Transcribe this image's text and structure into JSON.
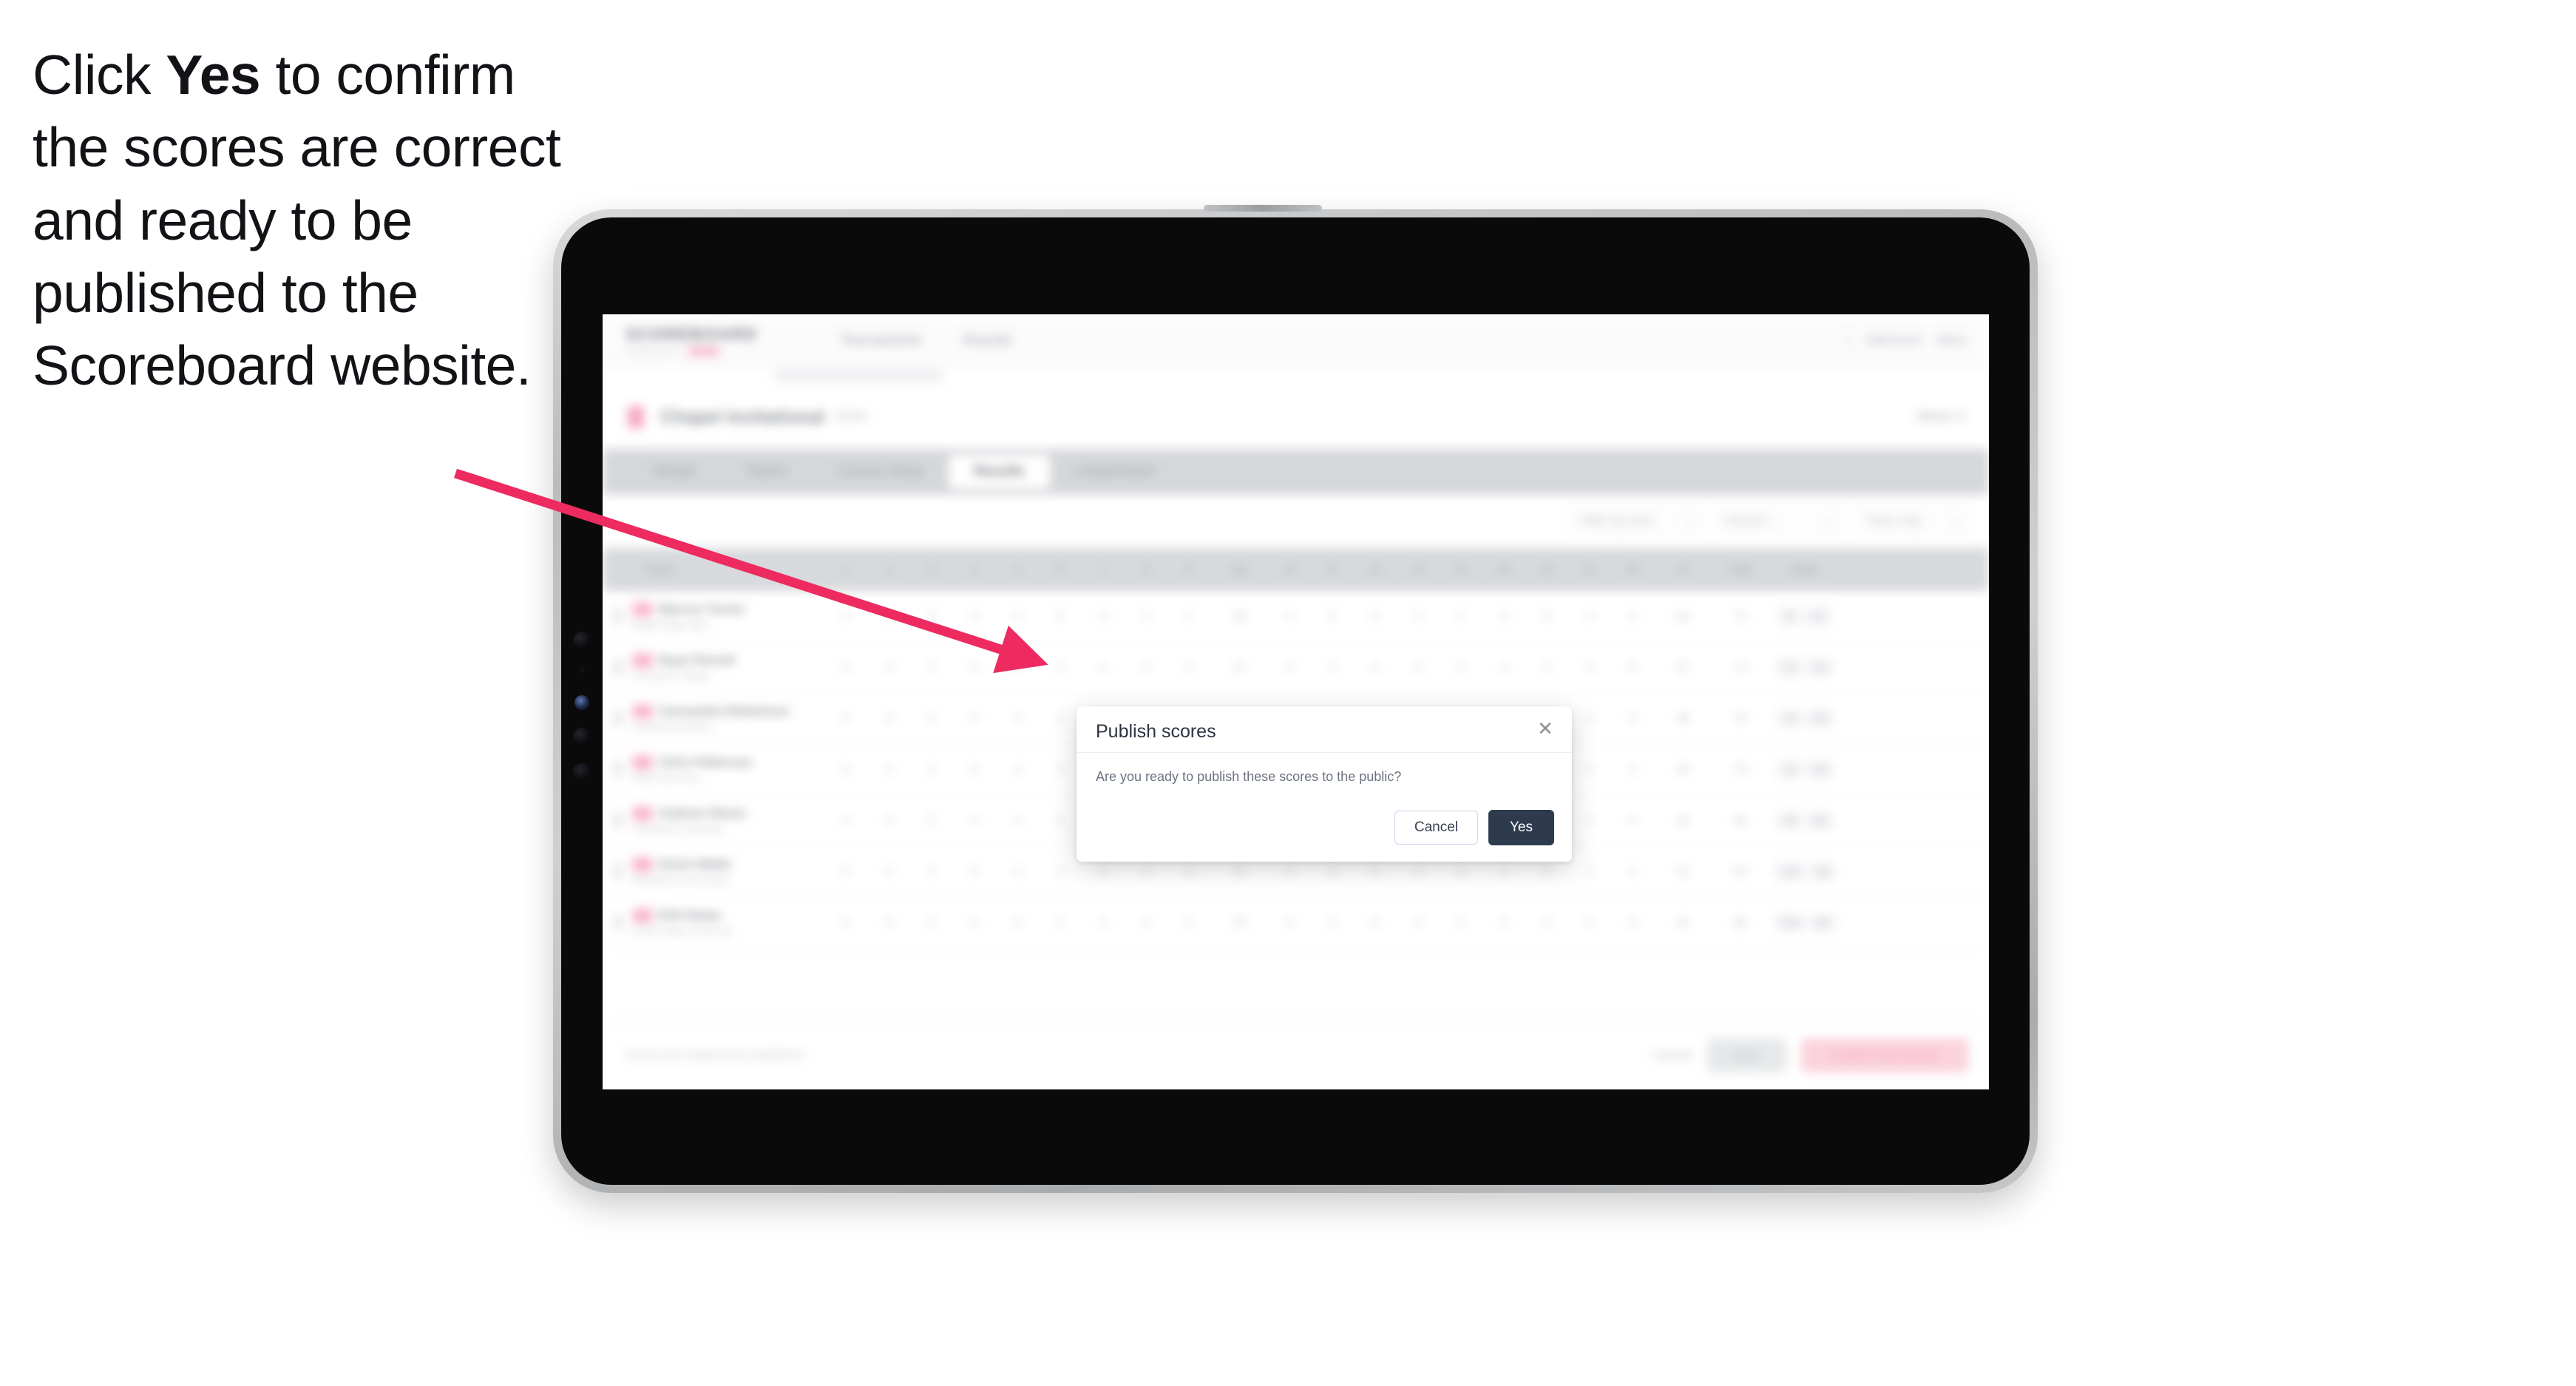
{
  "instruction": {
    "prefix": "Click ",
    "emphasis": "Yes",
    "suffix": " to confirm the scores are correct and ready to be published to the Scoreboard website."
  },
  "colors": {
    "arrow": "#ED2B60",
    "modal_primary": "#2E3B4E",
    "modal_cancel_border": "#CBD6E8",
    "brand_pink": "#F8B6C8",
    "device_bezel": "#C6C7C9"
  },
  "device": {
    "type": "tablet",
    "orientation": "landscape"
  },
  "app": {
    "brand": {
      "name": "SCOREBOARD",
      "tagline": "POWERED BY",
      "badge": ""
    },
    "nav": [
      {
        "label": "Tournaments"
      },
      {
        "label": "Rounds"
      }
    ],
    "nav_right": [
      {
        "label": "Add Event"
      },
      {
        "label": "Menu"
      }
    ],
    "subnav_chip": "",
    "event": {
      "title": "Chapel Invitational",
      "subtitle": "2024",
      "right_label": "Week 3"
    },
    "tabs": [
      {
        "label": "Details",
        "active": false
      },
      {
        "label": "Teams",
        "active": false
      },
      {
        "label": "Course Setup",
        "active": false
      },
      {
        "label": "Results",
        "active": true
      },
      {
        "label": "Leaderboard",
        "active": false
      }
    ],
    "filters": [
      {
        "label": "Filter by team",
        "type": "select"
      },
      {
        "label": "Round 1",
        "type": "select"
      },
      {
        "label": "Team only",
        "type": "select"
      }
    ],
    "table": {
      "columns": [
        {
          "label": "Player",
          "kind": "player"
        },
        {
          "label": "1",
          "kind": "hole"
        },
        {
          "label": "2",
          "kind": "hole"
        },
        {
          "label": "3",
          "kind": "hole"
        },
        {
          "label": "4",
          "kind": "hole"
        },
        {
          "label": "5",
          "kind": "hole"
        },
        {
          "label": "6",
          "kind": "hole"
        },
        {
          "label": "7",
          "kind": "hole"
        },
        {
          "label": "8",
          "kind": "hole"
        },
        {
          "label": "9",
          "kind": "hole"
        },
        {
          "label": "Out",
          "kind": "wide"
        },
        {
          "label": "10",
          "kind": "hole"
        },
        {
          "label": "11",
          "kind": "hole"
        },
        {
          "label": "12",
          "kind": "hole"
        },
        {
          "label": "13",
          "kind": "hole"
        },
        {
          "label": "14",
          "kind": "hole"
        },
        {
          "label": "15",
          "kind": "hole"
        },
        {
          "label": "16",
          "kind": "hole"
        },
        {
          "label": "17",
          "kind": "hole"
        },
        {
          "label": "18",
          "kind": "hole"
        },
        {
          "label": "In",
          "kind": "wide"
        },
        {
          "label": "Total",
          "kind": "wide"
        },
        {
          "label": "Status",
          "kind": "wider"
        }
      ],
      "rows": [
        {
          "rank": "1st",
          "name": "Marcus Turner",
          "sub": "Eagle Ridge High",
          "scores": [
            "4",
            "5",
            "3",
            "4",
            "4",
            "5",
            "3",
            "4",
            "4"
          ],
          "out": "36",
          "scores_in": [
            "4",
            "3",
            "5",
            "4",
            "4",
            "3",
            "5",
            "4",
            "4"
          ],
          "in": "36",
          "total": "72",
          "status_a": "E",
          "status_b": "72"
        },
        {
          "rank": "2nd",
          "name": "Ryan Parnell",
          "sub": "Crestview College",
          "scores": [
            "5",
            "4",
            "4",
            "3",
            "5",
            "4",
            "4",
            "4",
            "4"
          ],
          "out": "37",
          "scores_in": [
            "4",
            "4",
            "4",
            "5",
            "3",
            "4",
            "4",
            "4",
            "5"
          ],
          "in": "37",
          "total": "74",
          "status_a": "+2",
          "status_b": "74"
        },
        {
          "rank": "3rd",
          "name": "Cassandra Robertson",
          "sub": "Lakeside Academy",
          "scores": [
            "4",
            "4",
            "5",
            "4",
            "4",
            "4",
            "4",
            "5",
            "4"
          ],
          "out": "38",
          "scores_in": [
            "4",
            "5",
            "4",
            "4",
            "4",
            "4",
            "5",
            "4",
            "4"
          ],
          "in": "38",
          "total": "76",
          "status_a": "+4",
          "status_b": "76"
        },
        {
          "rank": "4th",
          "name": "Chris Patterson",
          "sub": "North Hills Prep",
          "scores": [
            "5",
            "4",
            "4",
            "5",
            "4",
            "4",
            "5",
            "4",
            "4"
          ],
          "out": "39",
          "scores_in": [
            "4",
            "4",
            "5",
            "4",
            "5",
            "4",
            "4",
            "5",
            "4"
          ],
          "in": "39",
          "total": "78",
          "status_a": "+6",
          "status_b": "78"
        },
        {
          "rank": "5th",
          "name": "Andrew Sheen",
          "sub": "Southbank University",
          "scores": [
            "4",
            "5",
            "5",
            "4",
            "4",
            "5",
            "4",
            "5",
            "4"
          ],
          "out": "40",
          "scores_in": [
            "5",
            "4",
            "4",
            "5",
            "4",
            "5",
            "4",
            "4",
            "5"
          ],
          "in": "40",
          "total": "80",
          "status_a": "+8",
          "status_b": "80"
        },
        {
          "rank": "6th",
          "name": "Devin Webb",
          "sub": "Westbrook Community",
          "scores": [
            "5",
            "5",
            "4",
            "5",
            "4",
            "5",
            "5",
            "4",
            "4"
          ],
          "out": "41",
          "scores_in": [
            "4",
            "5",
            "5",
            "4",
            "5",
            "4",
            "5",
            "5",
            "4"
          ],
          "in": "41",
          "total": "82",
          "status_a": "+10",
          "status_b": "82"
        },
        {
          "rank": "7th",
          "name": "Erik Nolan",
          "sub": "Grand Valley University",
          "scores": [
            "5",
            "5",
            "5",
            "4",
            "5",
            "5",
            "4",
            "5",
            "5"
          ],
          "out": "43",
          "scores_in": [
            "5",
            "4",
            "5",
            "5",
            "5",
            "4",
            "5",
            "5",
            "5"
          ],
          "in": "43",
          "total": "86",
          "status_a": "+14",
          "status_b": "86"
        }
      ]
    },
    "footer": {
      "note": "Scores are locked once published.",
      "link_label": "Cancel",
      "secondary_label": "Save",
      "primary_label": "Publish final scores"
    }
  },
  "modal": {
    "title": "Publish scores",
    "close_icon": "close-icon",
    "body": "Are you ready to publish these scores to the public?",
    "cancel_label": "Cancel",
    "confirm_label": "Yes"
  }
}
